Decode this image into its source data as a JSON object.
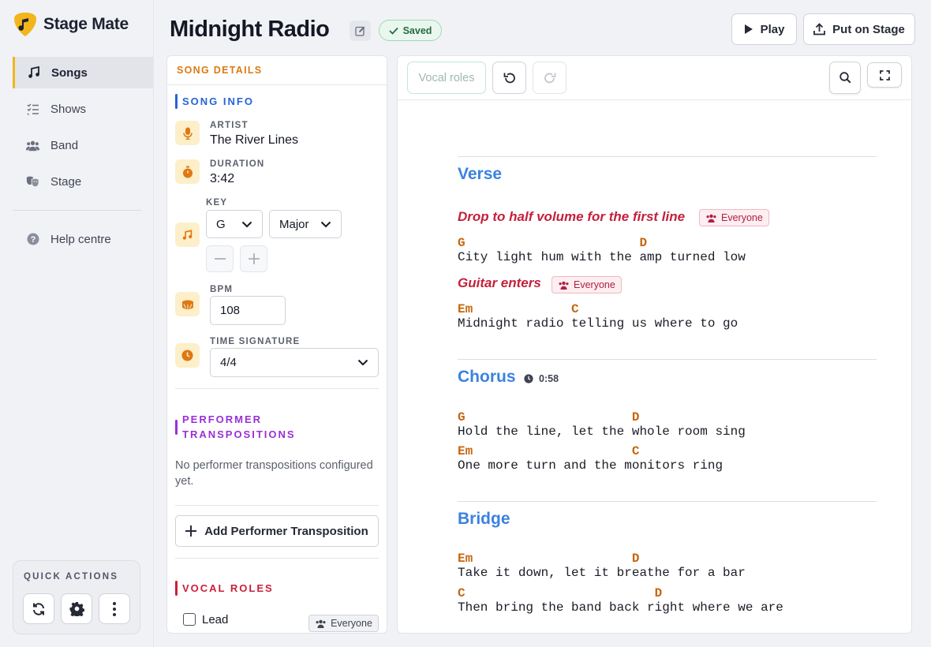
{
  "app": {
    "name": "Stage Mate",
    "accent": "#f2b51c"
  },
  "sidebar": {
    "items": [
      {
        "label": "Songs",
        "icon": "music-note-icon",
        "active": true
      },
      {
        "label": "Shows",
        "icon": "checklist-icon",
        "active": false
      },
      {
        "label": "Band",
        "icon": "people-icon",
        "active": false
      },
      {
        "label": "Stage",
        "icon": "theater-masks-icon",
        "active": false
      },
      {
        "label": "Help centre",
        "icon": "question-circle-icon",
        "active": false
      }
    ],
    "quick_actions": {
      "title": "QUICK ACTIONS",
      "buttons": [
        "refresh-icon",
        "gear-icon",
        "more-vertical-icon"
      ]
    }
  },
  "header": {
    "title": "Midnight Radio",
    "saved_label": "Saved",
    "play_label": "Play",
    "put_on_stage_label": "Put on Stage"
  },
  "details": {
    "panel_title": "SONG DETAILS",
    "song_info_title": "SONG INFO",
    "artist_label": "ARTIST",
    "artist_value": "The River Lines",
    "duration_label": "DURATION",
    "duration_value": "3:42",
    "key_label": "KEY",
    "key_value": "G",
    "mode_value": "Major",
    "bpm_label": "BPM",
    "bpm_value": "108",
    "time_sig_label": "TIME SIGNATURE",
    "time_sig_value": "4/4",
    "performer_title_1": "PERFORMER",
    "performer_title_2": "TRANSPOSITIONS",
    "performer_empty": "No performer transpositions configured yet.",
    "add_transposition_label": "Add Performer Transposition",
    "vocal_roles_title": "VOCAL ROLES",
    "vocal_roles": [
      {
        "name": "Lead",
        "checked": false,
        "badge": "Everyone"
      }
    ]
  },
  "toolbar": {
    "vocal_roles_label": "Vocal roles"
  },
  "sheet": {
    "sections": [
      {
        "name": "Verse",
        "note1": "Drop to half volume for the first line",
        "note1_badge": "Everyone",
        "chords1": "G                       D",
        "lyrics1": "City light hum with the amp turned low",
        "note2": "Guitar enters",
        "note2_badge": "Everyone",
        "chords2": "Em             C",
        "lyrics2": "Midnight radio telling us where to go"
      },
      {
        "name": "Chorus",
        "duration": "0:58",
        "chords1": "G                      D",
        "lyrics1": "Hold the line, let the whole room sing",
        "chords2": "Em                     C",
        "lyrics2": "One more turn and the monitors ring"
      },
      {
        "name": "Bridge",
        "chords1": "Em                     D",
        "lyrics1": "Take it down, let it breathe for a bar",
        "chords2": "C                         D",
        "lyrics2": "Then bring the band back right where we are"
      }
    ]
  }
}
